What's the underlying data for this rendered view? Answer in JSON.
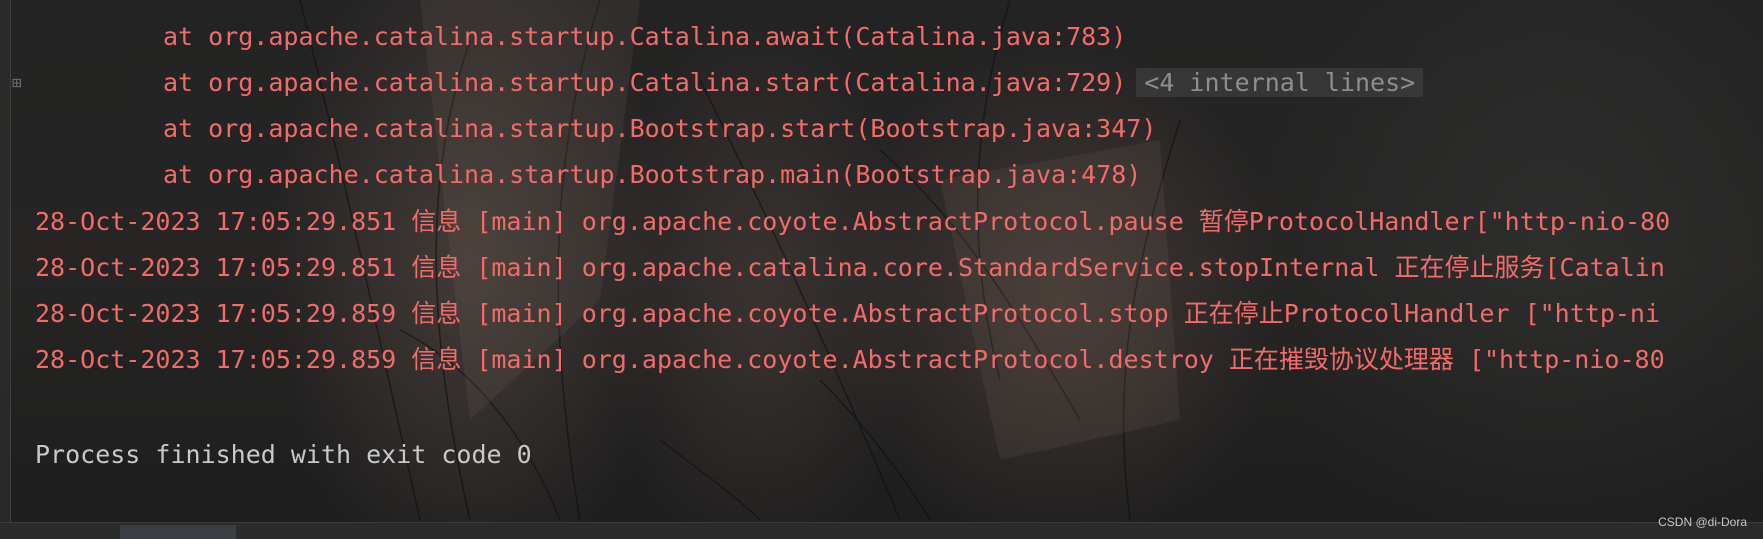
{
  "console": {
    "stack_lines": [
      "at org.apache.catalina.startup.Catalina.await(Catalina.java:783)",
      "at org.apache.catalina.startup.Catalina.start(Catalina.java:729)",
      "at org.apache.catalina.startup.Bootstrap.start(Bootstrap.java:347)",
      "at org.apache.catalina.startup.Bootstrap.main(Bootstrap.java:478)"
    ],
    "folded_label": "<4 internal lines>",
    "log_lines": [
      "28-Oct-2023 17:05:29.851 信息 [main] org.apache.coyote.AbstractProtocol.pause 暂停ProtocolHandler[\"http-nio-80",
      "28-Oct-2023 17:05:29.851 信息 [main] org.apache.catalina.core.StandardService.stopInternal 正在停止服务[Catalin",
      "28-Oct-2023 17:05:29.859 信息 [main] org.apache.coyote.AbstractProtocol.stop 正在停止ProtocolHandler [\"http-ni",
      "28-Oct-2023 17:05:29.859 信息 [main] org.apache.coyote.AbstractProtocol.destroy 正在摧毁协议处理器 [\"http-nio-80"
    ],
    "exit_message": "Process finished with exit code 0"
  },
  "icons": {
    "fold": "expand-plus-icon"
  },
  "colors": {
    "error_text": "#f26b6b",
    "normal_text": "#c9c9c9",
    "folded_text": "#8e8e8e"
  },
  "watermark": "CSDN @di-Dora"
}
